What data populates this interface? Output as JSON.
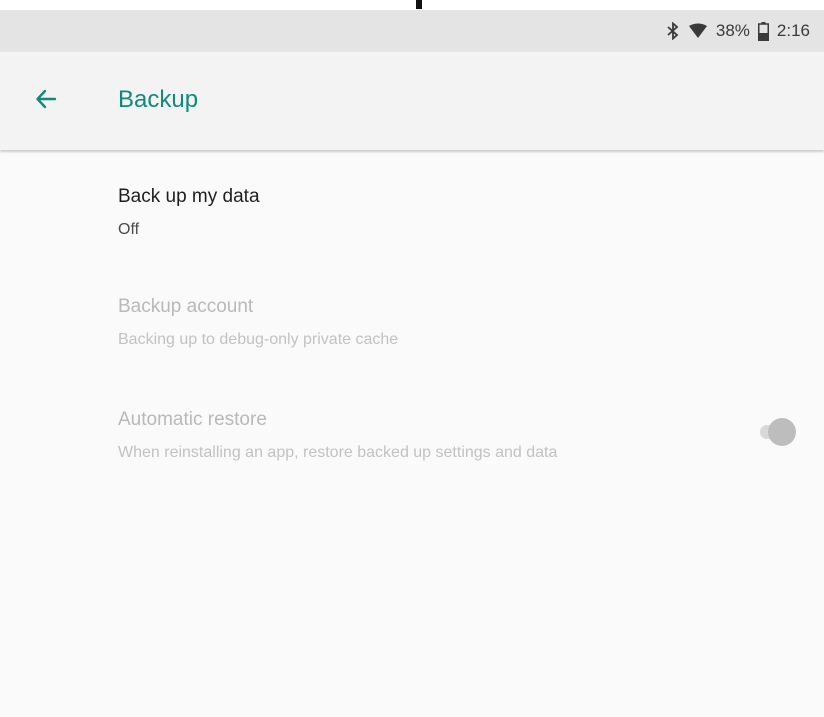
{
  "status_bar": {
    "battery_percent": "38%",
    "time": "2:16",
    "icons": [
      "bluetooth-icon",
      "wifi-icon",
      "battery-icon"
    ]
  },
  "app_bar": {
    "title": "Backup",
    "back_icon": "arrow-left-icon"
  },
  "preferences": [
    {
      "title": "Back up my data",
      "summary": "Off",
      "enabled": true
    },
    {
      "title": "Backup account",
      "summary": "Backing up to debug-only private cache",
      "enabled": false
    },
    {
      "title": "Automatic restore",
      "summary": "When reinstalling an app, restore backed up settings and data",
      "enabled": false,
      "toggle_on": false
    }
  ],
  "colors": {
    "accent": "#0f8a7e",
    "status_bar_bg": "#e4e4e4",
    "app_bar_bg": "#f3f3f3",
    "page_bg": "#fafafa"
  }
}
